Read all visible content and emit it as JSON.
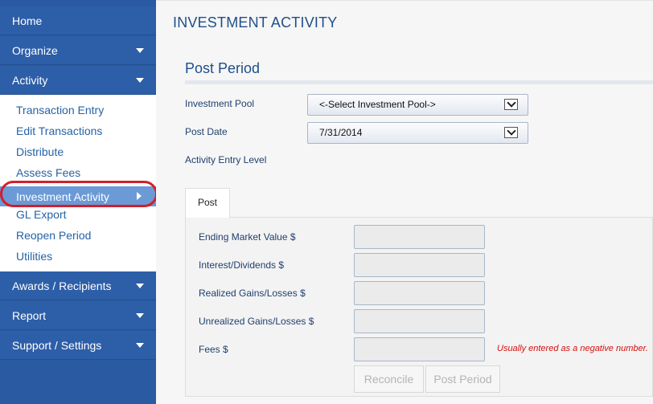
{
  "sidebar": {
    "top_items": [
      {
        "label": "Home"
      },
      {
        "label": "Organize"
      },
      {
        "label": "Activity"
      }
    ],
    "activity_submenu": [
      {
        "label": "Transaction Entry"
      },
      {
        "label": "Edit Transactions"
      },
      {
        "label": "Distribute"
      },
      {
        "label": "Assess Fees"
      },
      {
        "label": "Investment Activity",
        "active": true
      },
      {
        "label": "GL Export"
      },
      {
        "label": "Reopen Period"
      },
      {
        "label": "Utilities"
      }
    ],
    "bottom_items": [
      {
        "label": "Awards / Recipients"
      },
      {
        "label": "Report"
      },
      {
        "label": "Support / Settings"
      }
    ]
  },
  "main": {
    "page_title": "INVESTMENT ACTIVITY",
    "section_title": "Post Period",
    "form": {
      "investment_pool_label": "Investment Pool",
      "investment_pool_value": "<-Select Investment Pool->",
      "post_date_label": "Post Date",
      "post_date_value": "7/31/2014",
      "entry_level_label": "Activity Entry Level"
    },
    "tabs": [
      {
        "label": "Post"
      }
    ],
    "post_panel": {
      "fields": [
        {
          "label": "Ending Market Value $",
          "value": ""
        },
        {
          "label": "Interest/Dividends $",
          "value": ""
        },
        {
          "label": "Realized Gains/Losses $",
          "value": ""
        },
        {
          "label": "Unrealized Gains/Losses $",
          "value": ""
        },
        {
          "label": "Fees $",
          "value": ""
        }
      ],
      "fees_note": "Usually entered as a negative number.",
      "reconcile_label": "Reconcile",
      "post_period_label": "Post Period"
    }
  },
  "colors": {
    "sidebar_bg": "#2d5ea8",
    "active_item_bg": "#6b9ad6",
    "link_text": "#2563a6",
    "title_text": "#1f4f8a",
    "highlight_oval": "#d21f2a",
    "note_text": "#d41010"
  }
}
